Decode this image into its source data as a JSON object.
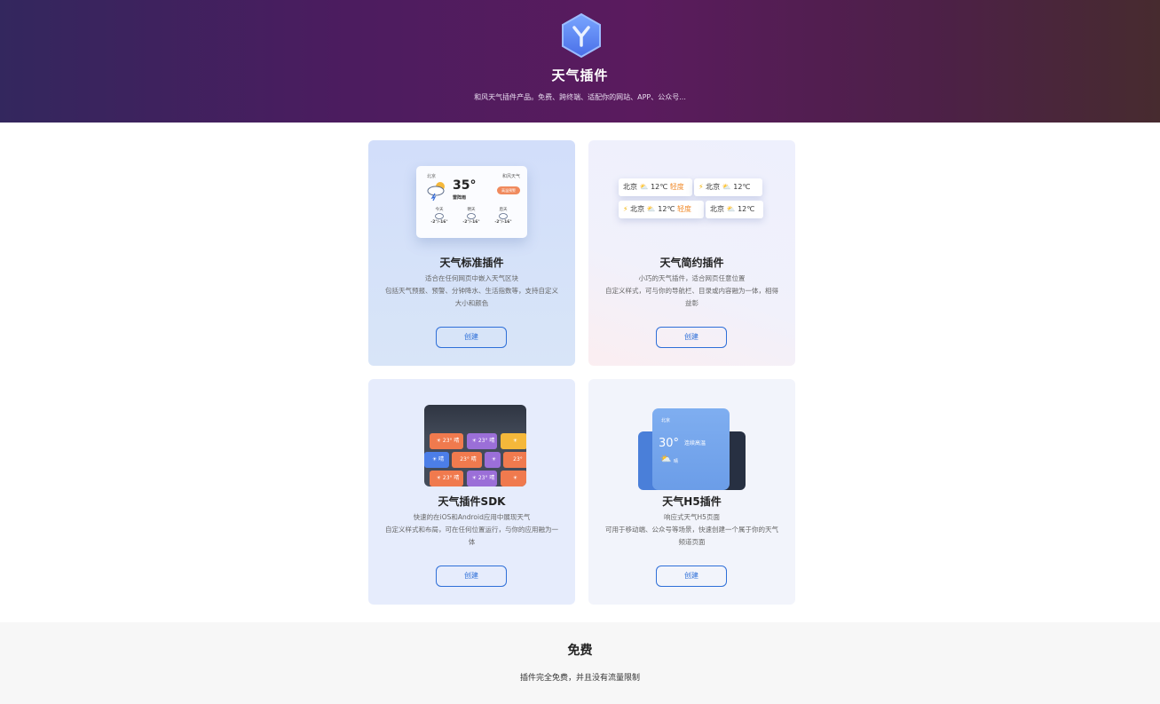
{
  "hero": {
    "title": "天气插件",
    "subtitle": "和风天气插件产品。免费、跨终端、适配你的网站、APP、公众号..."
  },
  "cards": [
    {
      "title": "天气标准插件",
      "desc": [
        "适合在任何网页中嵌入天气区块",
        "包括天气预报、预警、分钟降水、生活指数等，支持自定义大小和颜色"
      ],
      "button": "创建",
      "preview": {
        "city": "北京",
        "brand": "和风天气",
        "temp": "35°",
        "condition": "雷阵雨",
        "badge": "高温预警",
        "days": [
          {
            "name": "今天",
            "range": "-2°/-16°"
          },
          {
            "name": "明天",
            "range": "-2°/-16°"
          },
          {
            "name": "后天",
            "range": "-2°/-16°"
          }
        ]
      }
    },
    {
      "title": "天气简约插件",
      "desc": [
        "小巧的天气插件，适合网页任意位置",
        "自定义样式，可与你的导航栏、目录或内容融为一体，相得益彰"
      ],
      "button": "创建",
      "preview": {
        "chips": [
          {
            "city": "北京",
            "temp": "12℃",
            "tag": "轻度"
          },
          {
            "city": "北京",
            "temp": "12℃",
            "tag": ""
          },
          {
            "city": "北京",
            "temp": "12℃",
            "tag": "轻度"
          },
          {
            "city": "北京",
            "temp": "12℃",
            "tag": ""
          }
        ]
      }
    },
    {
      "title": "天气插件SDK",
      "desc": [
        "快速的在iOS和Android应用中展现天气",
        "自定义样式和布局，可在任何位置运行，与你的应用融为一体"
      ],
      "button": "创建",
      "preview": {
        "tile_text": "23° 晴",
        "colors": {
          "orange": "#f07a4e",
          "purple": "#9b6fd8",
          "yellow": "#f5b83a",
          "blue": "#4c7ee8"
        }
      }
    },
    {
      "title": "天气H5插件",
      "desc": [
        "响应式天气H5页面",
        "可用于移动端、公众号等场景，快速创建一个属于你的天气频道页面"
      ],
      "button": "创建",
      "preview": {
        "city": "北京",
        "temp": "30°",
        "condition": "晴",
        "headline": "连续高温"
      }
    }
  ],
  "free": {
    "title": "免费",
    "desc": "插件完全免费，并且没有流量限制"
  },
  "colors": {
    "accent": "#2e6fd8",
    "warning": "#f08a5d"
  }
}
